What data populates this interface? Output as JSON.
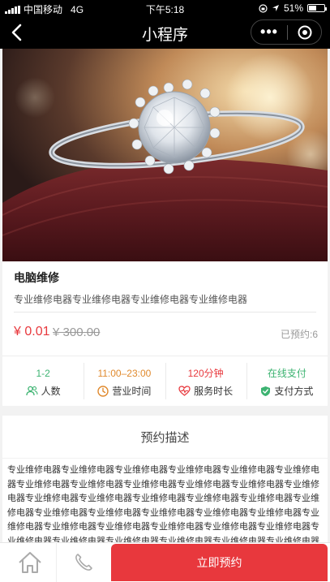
{
  "status_bar": {
    "carrier": "中国移动",
    "network": "4G",
    "time": "下午5:18",
    "battery_percent": "51%",
    "battery_level": 0.51
  },
  "navbar": {
    "title": "小程序",
    "menu_label": "•••"
  },
  "product": {
    "title": "电脑维修",
    "subtitle": "专业维修电器专业维修电器专业维修电器专业维修电器",
    "price": "¥ 0.01",
    "original_price": "¥ 300.00",
    "booked_label": "已预约:",
    "booked_count": "6"
  },
  "stats": [
    {
      "value": "1-2",
      "label": "人数",
      "color": "#3cb371",
      "icon": "people-icon"
    },
    {
      "value": "11:00–23:00",
      "label": "营业时间",
      "color": "#e08a2e",
      "icon": "clock-icon"
    },
    {
      "value": "120分钟",
      "label": "服务时长",
      "color": "#e8383d",
      "icon": "heart-pulse-icon"
    },
    {
      "value": "在线支付",
      "label": "支付方式",
      "color": "#3cb371",
      "icon": "shield-check-icon"
    }
  ],
  "description": {
    "heading": "预约描述",
    "body": "专业维修电器专业维修电器专业维修电器专业维修电器专业维修电器专业维修电器专业维修电器专业维修电器专业维修电器专业维修电器专业维修电器专业维修电器专业维修电器专业维修电器专业维修电器专业维修电器专业维修电器专业维修电器专业维修电器专业维修电器专业维修电器专业维修电器专业维修电器专业维修电器专业维修电器专业维修电器专业维修电器专业维修电器专业维修电器专业维修电器专业维修电器专业维修电器专业维修电器专业维修电器专业维修电器专业维修电器"
  },
  "bottom_bar": {
    "book_label": "立即预约"
  },
  "colors": {
    "accent": "#e8383d",
    "green": "#3cb371",
    "orange": "#e08a2e"
  }
}
